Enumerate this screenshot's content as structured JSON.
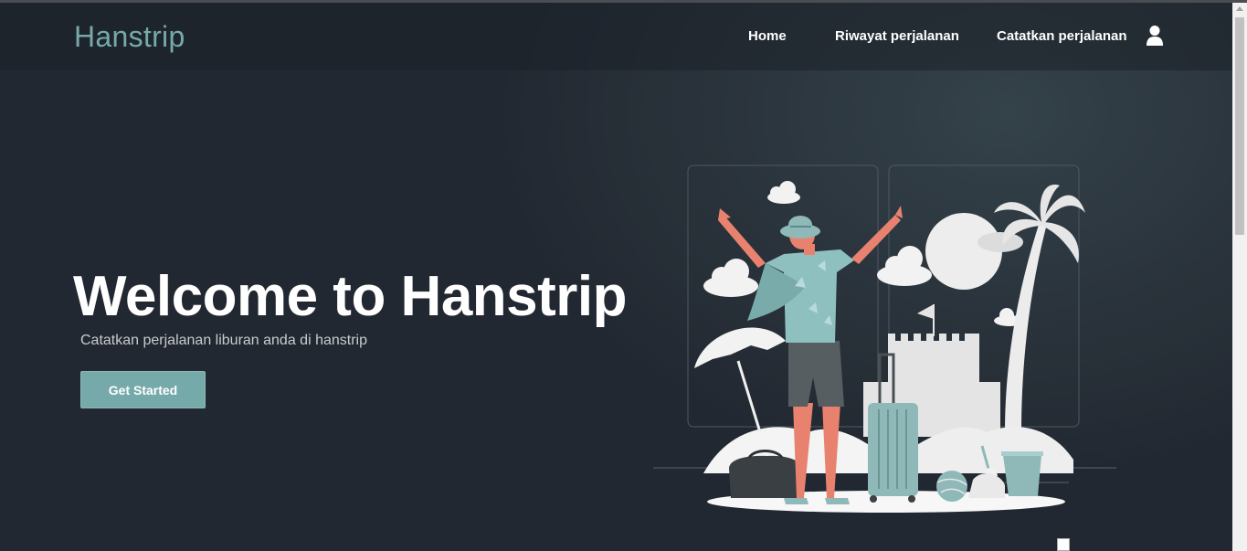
{
  "navbar": {
    "brand": "Hanstrip",
    "links": [
      {
        "label": "Home"
      },
      {
        "label": "Riwayat perjalanan"
      },
      {
        "label": "Catatkan perjalanan"
      }
    ],
    "account_icon": "user-icon"
  },
  "hero": {
    "title": "Welcome to Hanstrip",
    "subtitle": "Catatkan perjalanan liburan anda di hanstrip",
    "cta_label": "Get Started",
    "illustration": "traveler-on-beach-illustration"
  },
  "footer_image": {
    "icon": "broken-image-icon"
  },
  "colors": {
    "background": "#222831",
    "accent": "#76a9aa",
    "text": "#ffffff",
    "muted_text": "#c8cbcf",
    "skin": "#e8826f",
    "shirt": "#8fc0c0"
  }
}
